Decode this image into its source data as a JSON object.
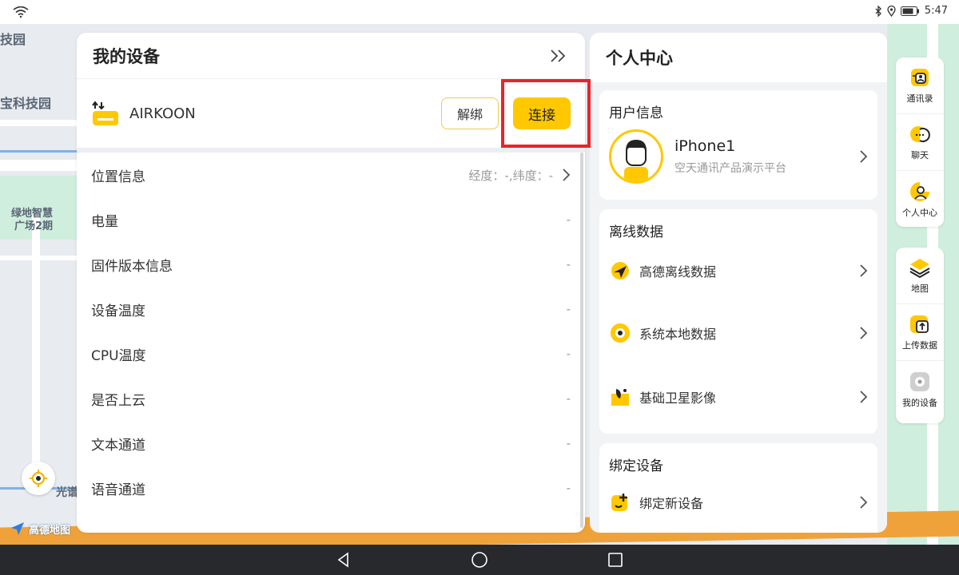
{
  "status_bar": {
    "time": "5:47"
  },
  "map": {
    "labels": [
      "技园",
      "宝科技园",
      "绿地智慧",
      "广场2期",
      "光谱"
    ],
    "logo_text": "高德地图"
  },
  "device_panel": {
    "title": "我的设备",
    "device_name": "AIRKOON",
    "unbind_label": "解绑",
    "connect_label": "连接",
    "info_rows": [
      {
        "label": "位置信息",
        "value": "经度：-,纬度：-"
      },
      {
        "label": "电量",
        "value": "-"
      },
      {
        "label": "固件版本信息",
        "value": "-"
      },
      {
        "label": "设备温度",
        "value": "-"
      },
      {
        "label": "CPU温度",
        "value": "-"
      },
      {
        "label": "是否上云",
        "value": "-"
      },
      {
        "label": "文本通道",
        "value": "-"
      },
      {
        "label": "语音通道",
        "value": "-"
      }
    ]
  },
  "personal_panel": {
    "title": "个人中心",
    "user_info": {
      "section_title": "用户信息",
      "name": "iPhone1",
      "subtitle": "空天通讯产品演示平台"
    },
    "offline_data": {
      "section_title": "离线数据",
      "items": [
        {
          "label": "高德离线数据",
          "icon": "amap-offline-icon"
        },
        {
          "label": "系统本地数据",
          "icon": "local-data-icon"
        },
        {
          "label": "基础卫星影像",
          "icon": "satellite-icon"
        }
      ]
    },
    "bind_device": {
      "section_title": "绑定设备",
      "items": [
        {
          "label": "绑定新设备",
          "icon": "bind-new-device-icon"
        }
      ]
    }
  },
  "toolbar": {
    "group1": [
      {
        "label": "通讯录",
        "icon": "contacts-icon"
      },
      {
        "label": "聊天",
        "icon": "chat-icon"
      },
      {
        "label": "个人中心",
        "icon": "personal-center-icon"
      }
    ],
    "group2": [
      {
        "label": "地图",
        "icon": "map-layers-icon"
      },
      {
        "label": "上传数据",
        "icon": "upload-data-icon"
      },
      {
        "label": "我的设备",
        "icon": "my-device-icon"
      }
    ]
  },
  "colors": {
    "accent": "#ffc800",
    "highlight": "#e8242b"
  }
}
